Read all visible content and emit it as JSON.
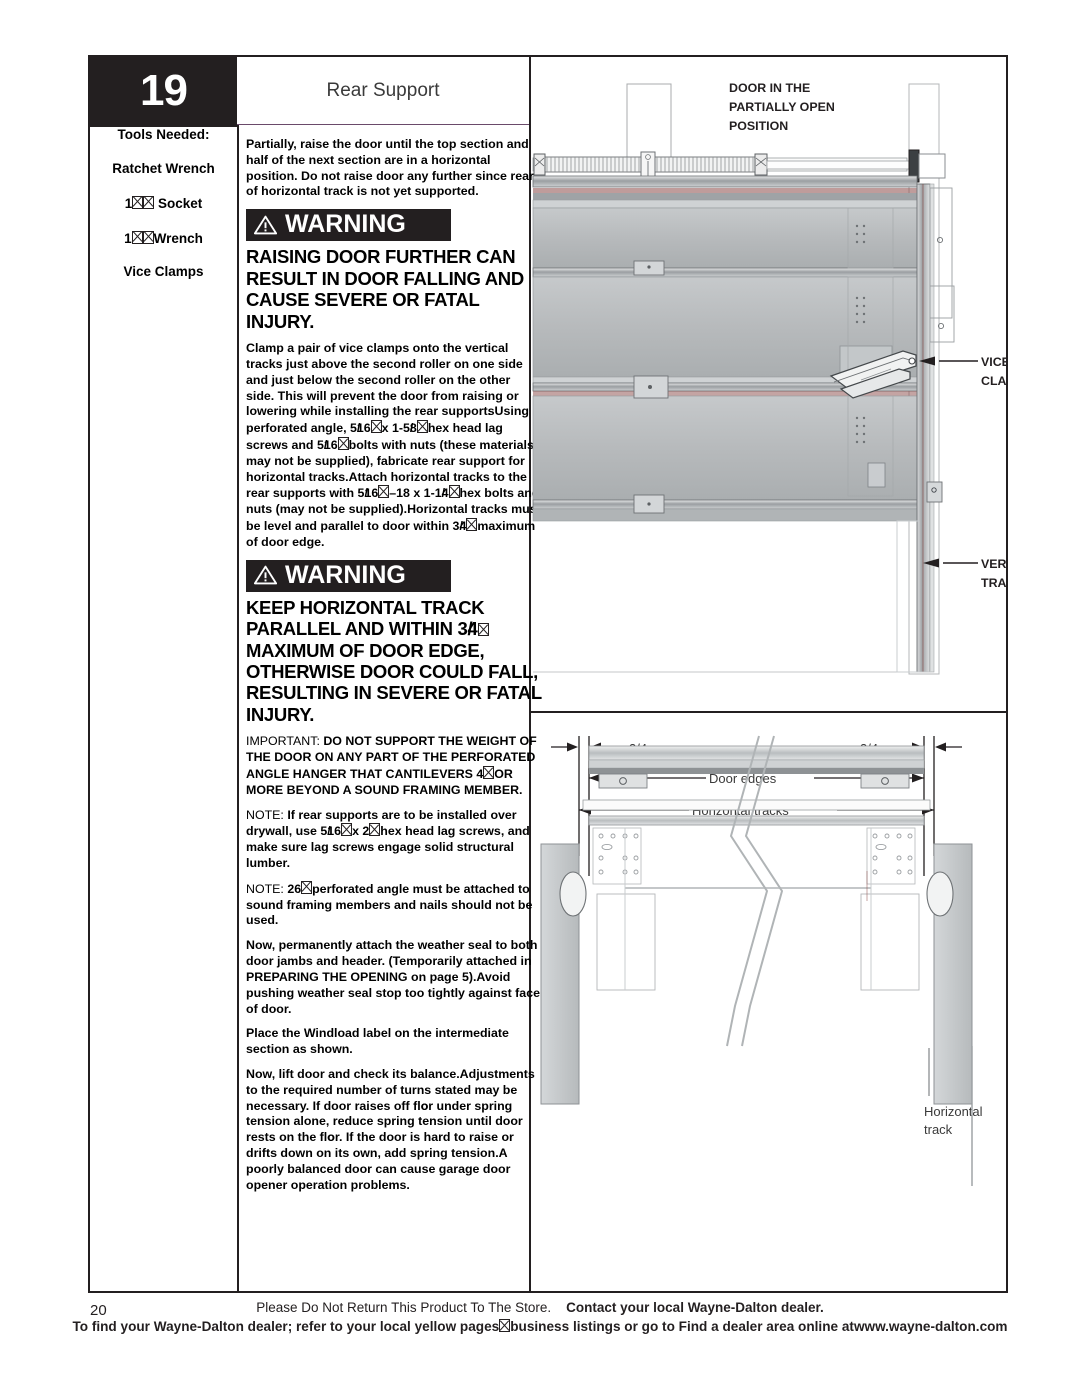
{
  "step": {
    "number": "19",
    "title": "Rear Support"
  },
  "tools": {
    "heading": "Tools Needed:",
    "items": [
      "Ratchet Wrench",
      "1/2\" Socket",
      "1/2\" Wrench",
      "Vice Clamps"
    ]
  },
  "instructions": {
    "intro": "Partially, raise the door until the top section and half of the next section are in a horizontal position. Do not raise door any further since rear of horizontal track is not yet supported.",
    "warning1": {
      "label": "WARNING",
      "body": "RAISING DOOR FURTHER CAN RESULT IN DOOR FALLING AND CAUSE SEVERE OR FATAL INJURY."
    },
    "body1": "Clamp a pair of vice clamps onto the vertical tracks just above the second roller on one side and just below the second roller on the other side. This will prevent the door from raising or lowering while installing the rear supports. Using perforated angle, 5/16\" x 1-5/8\" hex head lag screws and 5/16\" bolts with nuts (these materials may not be supplied), fabricate rear support for horizontal tracks. Attach horizontal tracks to the rear supports with 5/16\" - 18 x 1-1/4\" hex bolts and nuts (may not be supplied). Horizontal tracks must be level and parallel to door within 3/4\" maximum of door edge.",
    "warning2": {
      "label": "WARNING",
      "body": "KEEP HORIZONTAL TRACK PARALLEL AND WITHIN 3/4\" MAXIMUM OF DOOR EDGE, OTHERWISE DOOR COULD FALL, RESULTING IN SEVERE OR FATAL INJURY."
    },
    "important_label": "IMPORTANT:",
    "important_body": "DO NOT SUPPORT THE WEIGHT OF THE DOOR ON ANY PART OF THE PERFORATED ANGLE HANGER THAT CANTILEVERS 4\" OR MORE BEYOND A SOUND FRAMING MEMBER.",
    "note_label": "NOTE:",
    "note1": "If rear supports are to be installed over drywall, use 5/16\" x 2\" hex head lag screws, and make sure lag screws engage solid structural lumber.",
    "note2": "26\" perforated angle must be attached to sound framing members and nails should not be used.",
    "body2": "Now, permanently attach the weather seal to both door jambs and header. (Temporarily attached in PREPARING THE OPENING on page 5). Avoid pushing weather seal stop too tightly against face of door.",
    "body3": "Place the Windload label on the intermediate section as shown.",
    "body4": "Now, lift door and check its balance. Adjustments to the required number of turns stated may be necessary. If door raises off floor under spring tension alone, reduce spring tension until door rests on the floor. If the door is hard to raise or drifts down on its own, add spring tension. A poorly balanced door can cause garage door opener operation problems."
  },
  "diagram_top": {
    "title": "DOOR IN THE PARTIALLY OPEN POSITION",
    "title_lines": [
      "DOOR IN THE",
      "PARTIALLY OPEN",
      "POSITION"
    ],
    "callout_vice_clamps": [
      "VICE",
      "CLAMPS"
    ],
    "callout_vertical_track": [
      "VERTICAL",
      "TRACK"
    ]
  },
  "diagram_bottom": {
    "dim_left": "3/4",
    "dim_right": "3/4",
    "label_door_edges": "Door edges",
    "label_horizontal_tracks": "Horizontal tracks",
    "label_horizontal_track": [
      "Horizontal",
      "track"
    ]
  },
  "footer": {
    "page_number": "20",
    "line1_a": "Please Do Not Return This Product To The Store.",
    "line1_b": "Contact your local Wayne-Dalton dealer.",
    "line2_a": "To find your Wayne-Dalton dealer; refer to your local yellow pages",
    "line2_b": "business listings or go to Find a dealer area online at",
    "line2_c": "www.wayne-dalton.com"
  },
  "colors": {
    "ink": "#231f20",
    "panel": "#b9bcbe",
    "panel_dark": "#8e9295",
    "accent_rule": "#6a4a6a"
  }
}
